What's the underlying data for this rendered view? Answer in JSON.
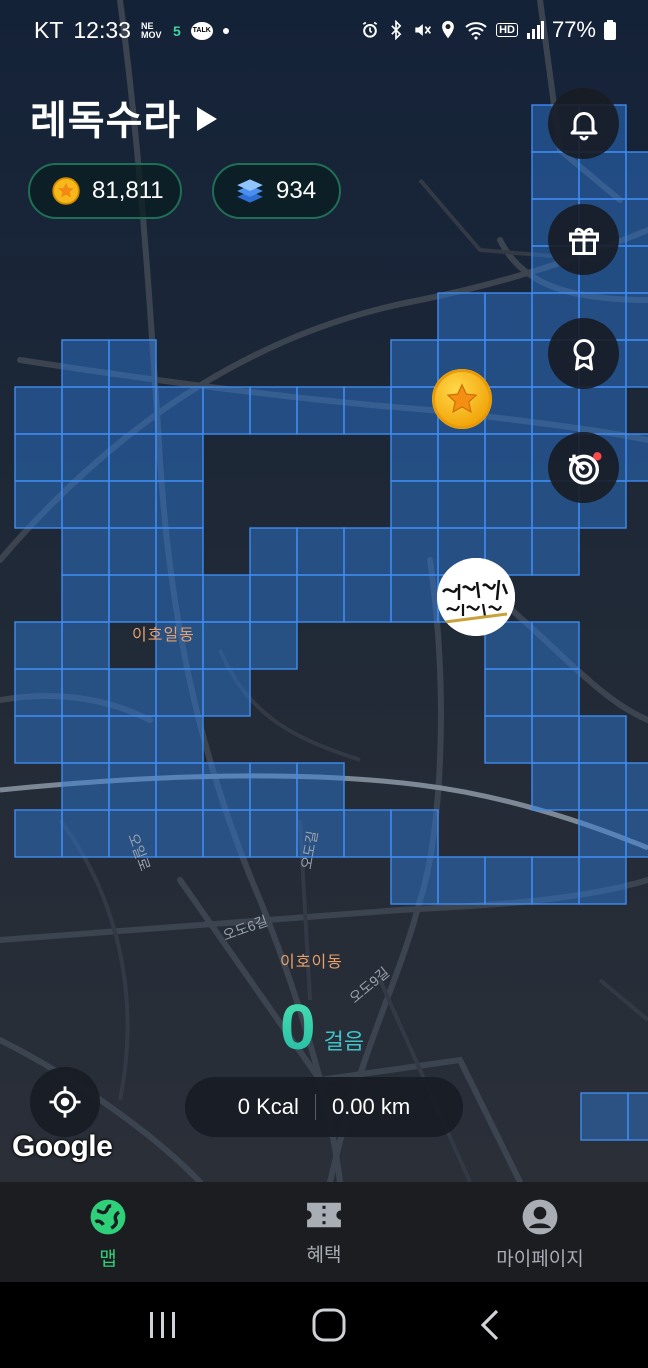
{
  "status_bar": {
    "carrier": "KT",
    "time": "12:33",
    "icon_labels": [
      "NE MOV",
      "5",
      "TALK"
    ],
    "hd_label": "HD",
    "battery": "77%"
  },
  "header": {
    "title": "레독수라",
    "coins": "81,811",
    "layers": "934"
  },
  "map": {
    "labels": {
      "area1": "이호일동",
      "area2": "이호이동"
    },
    "roads": [
      "오도6길",
      "오도9길",
      "오도길",
      "오일로"
    ],
    "google": "Google"
  },
  "activity": {
    "steps": "0",
    "steps_unit": "걸음",
    "kcal": "0 Kcal",
    "distance": "0.00 km"
  },
  "nav": {
    "items": [
      {
        "label": "맵",
        "icon": "map-globe-icon",
        "active": true
      },
      {
        "label": "혜택",
        "icon": "ticket-icon",
        "active": false
      },
      {
        "label": "마이페이지",
        "icon": "profile-icon",
        "active": false
      }
    ]
  },
  "colors": {
    "accent_green": "#2fd07a",
    "steps_gradient_top": "#4ce3b1",
    "tile_blue": "#2f7fe0",
    "coin_gold": "#f2a50a"
  }
}
